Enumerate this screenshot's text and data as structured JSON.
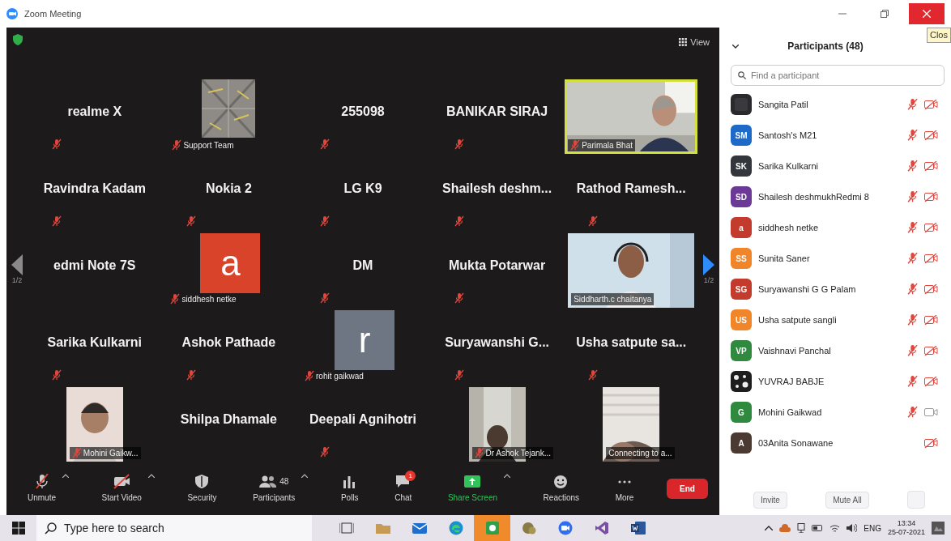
{
  "window": {
    "title": "Zoom Meeting",
    "tooltip": "Clos"
  },
  "stage": {
    "view_button": "View",
    "page_left": "1/2",
    "page_right": "1/2",
    "tiles": [
      {
        "kind": "name",
        "name": "realme X",
        "muted": true,
        "highlighted": false
      },
      {
        "name": "Support Team",
        "muted": true,
        "highlighted": false
      },
      {
        "kind": "name",
        "name": "255098",
        "muted": true,
        "highlighted": false
      },
      {
        "kind": "name",
        "name": "BANIKAR SIRAJ",
        "muted": true,
        "highlighted": false
      },
      {
        "kind": "video",
        "name": "Parimala Bhat",
        "muted": true,
        "highlighted": true
      },
      {
        "kind": "name",
        "name": "Ravindra Kadam",
        "muted": true,
        "highlighted": false
      },
      {
        "kind": "name",
        "name": "Nokia 2",
        "muted": true,
        "highlighted": false
      },
      {
        "kind": "name",
        "name": "LG K9",
        "muted": true,
        "highlighted": false
      },
      {
        "kind": "name",
        "name": "Shailesh  deshm...",
        "muted": true,
        "highlighted": false
      },
      {
        "kind": "name",
        "name": "Rathod  Ramesh...",
        "muted": true,
        "highlighted": false
      },
      {
        "kind": "name",
        "name": "edmi Note 7S",
        "muted": false,
        "highlighted": false
      },
      {
        "kind": "avatar",
        "name": "siddhesh netke",
        "letter": "a",
        "color": "#d9432a",
        "muted": true,
        "highlighted": false
      },
      {
        "kind": "name",
        "name": "DM",
        "muted": true,
        "highlighted": false
      },
      {
        "kind": "name",
        "name": "Mukta Potarwar",
        "muted": true,
        "highlighted": false
      },
      {
        "kind": "video",
        "name": "Siddharth.c chaitanya",
        "muted": false,
        "highlighted": false
      },
      {
        "kind": "name",
        "name": "Sarika Kulkarni",
        "muted": true,
        "highlighted": false
      },
      {
        "kind": "name",
        "name": "Ashok Pathade",
        "muted": true,
        "highlighted": false
      },
      {
        "kind": "avatar",
        "name": "rohit gaikwad",
        "letter": "r",
        "color": "#6f7683",
        "muted": true,
        "highlighted": false
      },
      {
        "kind": "name",
        "name": "Suryawanshi  G...",
        "muted": true,
        "highlighted": false
      },
      {
        "kind": "name",
        "name": "Usha  satpute  sa...",
        "muted": true,
        "highlighted": false
      },
      {
        "kind": "video",
        "name": "Mohini Gaikw...",
        "muted": true,
        "highlighted": false
      },
      {
        "kind": "name",
        "name": "Shilpa Dhamale",
        "muted": false,
        "highlighted": false
      },
      {
        "kind": "name",
        "name": "Deepali Agnihotri",
        "muted": true,
        "highlighted": false
      },
      {
        "kind": "video",
        "name": "Dr Ashok Tejank...",
        "muted": true,
        "highlighted": false
      },
      {
        "kind": "video",
        "name": "Connecting to a...",
        "muted": false,
        "highlighted": false
      }
    ]
  },
  "toolbar": [
    {
      "kind": "mic",
      "label": "Unmute",
      "caret": true
    },
    {
      "kind": "camera",
      "label": "Start Video",
      "caret": true
    },
    {
      "kind": "shield",
      "label": "Security",
      "caret": false
    },
    {
      "kind": "people",
      "label": "Participants",
      "count": "48",
      "caret": true
    },
    {
      "kind": "polls",
      "label": "Polls",
      "caret": false
    },
    {
      "kind": "chat",
      "label": "Chat",
      "badge": "1",
      "caret": false
    },
    {
      "kind": "share",
      "label": "Share Screen",
      "caret": true
    },
    {
      "kind": "reactions",
      "label": "Reactions",
      "caret": false
    },
    {
      "kind": "more",
      "label": "More",
      "caret": false
    },
    {
      "kind": "end",
      "label": "End",
      "caret": false
    }
  ],
  "participants_panel": {
    "title": "Participants (48)",
    "search": {
      "placeholder": "Find a participant"
    },
    "participants": [
      {
        "name": "Sangita Patil",
        "kind": "picture",
        "mic_muted": true,
        "video_on": false
      },
      {
        "name": "Santosh's M21",
        "initials": "SM",
        "color": "#1e6ac8",
        "mic_muted": true,
        "video_on": false
      },
      {
        "name": "Sarika Kulkarni",
        "initials": "SK",
        "color": "#33373d",
        "mic_muted": true,
        "video_on": false
      },
      {
        "name": "Shailesh deshmukhRedmi 8",
        "initials": "SD",
        "color": "#6a3a96",
        "mic_muted": true,
        "video_on": false
      },
      {
        "name": "siddhesh netke",
        "initials": "a",
        "color": "#c23b2c",
        "mic_muted": true,
        "video_on": false
      },
      {
        "name": "Sunita Saner",
        "initials": "SS",
        "color": "#f0852a",
        "mic_muted": true,
        "video_on": false
      },
      {
        "name": "Suryawanshi G G Palam",
        "initials": "SG",
        "color": "#c23b2c",
        "mic_muted": true,
        "video_on": false
      },
      {
        "name": "Usha satpute sangli",
        "initials": "US",
        "color": "#f0852a",
        "mic_muted": true,
        "video_on": false
      },
      {
        "name": "Vaishnavi Panchal",
        "initials": "VP",
        "color": "#2f8a3f",
        "mic_muted": true,
        "video_on": false
      },
      {
        "name": "YUVRAJ BABJE",
        "kind": "picture",
        "mic_muted": true,
        "video_on": false
      },
      {
        "name": "Mohini Gaikwad",
        "initials": "G",
        "color": "#2f8a3f",
        "mic_muted": true,
        "video_on": true
      },
      {
        "name": "03Anita Sonawane",
        "initials": "A",
        "color": "#4a3a32",
        "mic_muted": false,
        "video_on": false
      }
    ],
    "buttons": [
      "Invite",
      "Mute All"
    ]
  },
  "taskbar": {
    "search_placeholder": "Type here to search",
    "apps": [
      {
        "kind": "taskview",
        "active": false
      },
      {
        "kind": "folder",
        "active": false
      },
      {
        "kind": "mail",
        "active": false
      },
      {
        "kind": "edge",
        "active": false
      },
      {
        "kind": "greenapp",
        "active": true
      },
      {
        "kind": "bubble",
        "active": false
      },
      {
        "kind": "zoom",
        "active": false
      },
      {
        "kind": "vs",
        "active": false
      },
      {
        "kind": "word",
        "active": false
      }
    ],
    "language": "ENG",
    "time": "13:34",
    "date": "25-07-2021"
  }
}
